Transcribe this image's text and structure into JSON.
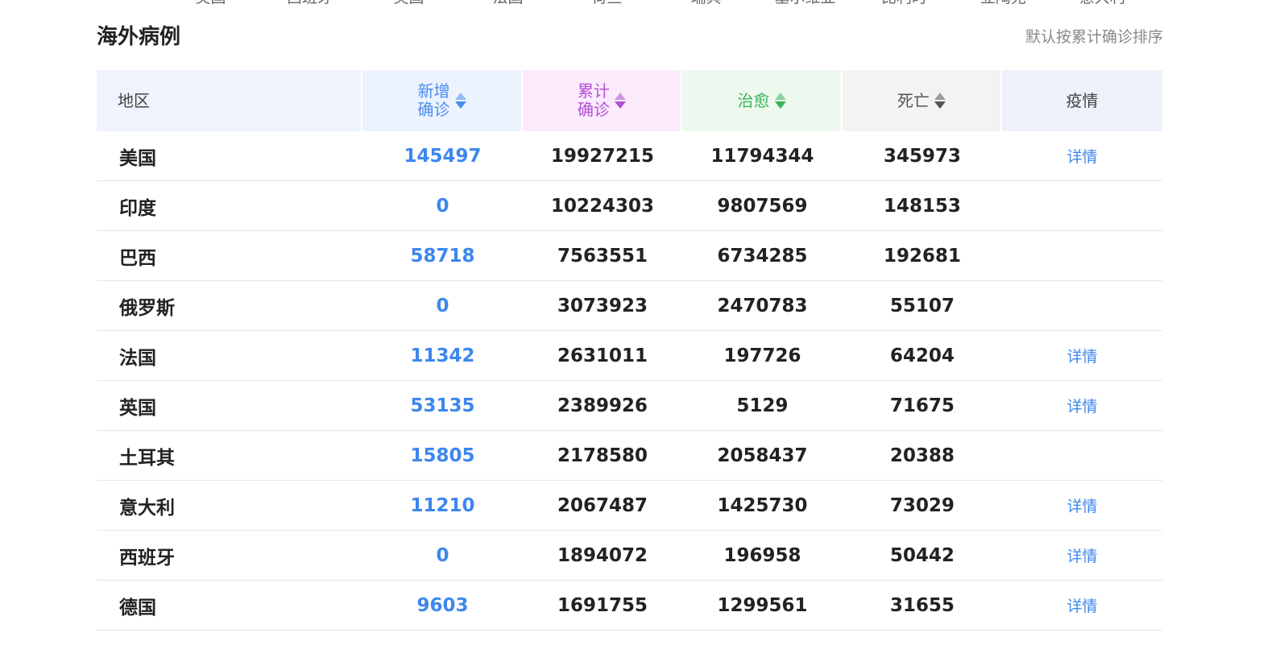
{
  "top_tabs": [
    "美国",
    "西班牙",
    "英国",
    "法国",
    "荷兰",
    "瑞典",
    "塞尔维亚",
    "比利时",
    "立陶宛",
    "意大利"
  ],
  "header": {
    "title": "海外病例",
    "sort_note": "默认按累计确诊排序"
  },
  "table": {
    "columns": {
      "region": "地区",
      "new_confirmed": "新增\n确诊",
      "total_confirmed": "累计\n确诊",
      "cured": "治愈",
      "deaths": "死亡",
      "detail": "疫情"
    },
    "detail_link_label": "详情",
    "rows": [
      {
        "region": "美国",
        "new": "145497",
        "total": "19927215",
        "cured": "11794344",
        "deaths": "345973",
        "detail": "详情"
      },
      {
        "region": "印度",
        "new": "0",
        "total": "10224303",
        "cured": "9807569",
        "deaths": "148153",
        "detail": ""
      },
      {
        "region": "巴西",
        "new": "58718",
        "total": "7563551",
        "cured": "6734285",
        "deaths": "192681",
        "detail": ""
      },
      {
        "region": "俄罗斯",
        "new": "0",
        "total": "3073923",
        "cured": "2470783",
        "deaths": "55107",
        "detail": ""
      },
      {
        "region": "法国",
        "new": "11342",
        "total": "2631011",
        "cured": "197726",
        "deaths": "64204",
        "detail": "详情"
      },
      {
        "region": "英国",
        "new": "53135",
        "total": "2389926",
        "cured": "5129",
        "deaths": "71675",
        "detail": "详情"
      },
      {
        "region": "土耳其",
        "new": "15805",
        "total": "2178580",
        "cured": "2058437",
        "deaths": "20388",
        "detail": ""
      },
      {
        "region": "意大利",
        "new": "11210",
        "total": "2067487",
        "cured": "1425730",
        "deaths": "73029",
        "detail": "详情"
      },
      {
        "region": "西班牙",
        "new": "0",
        "total": "1894072",
        "cured": "196958",
        "deaths": "50442",
        "detail": "详情"
      },
      {
        "region": "德国",
        "new": "9603",
        "total": "1691755",
        "cured": "1299561",
        "deaths": "31655",
        "detail": "详情"
      }
    ]
  },
  "colors": {
    "accent_blue": "#3d87ee",
    "total_purple": "#b34fd6",
    "cured_green": "#3cb55a"
  }
}
